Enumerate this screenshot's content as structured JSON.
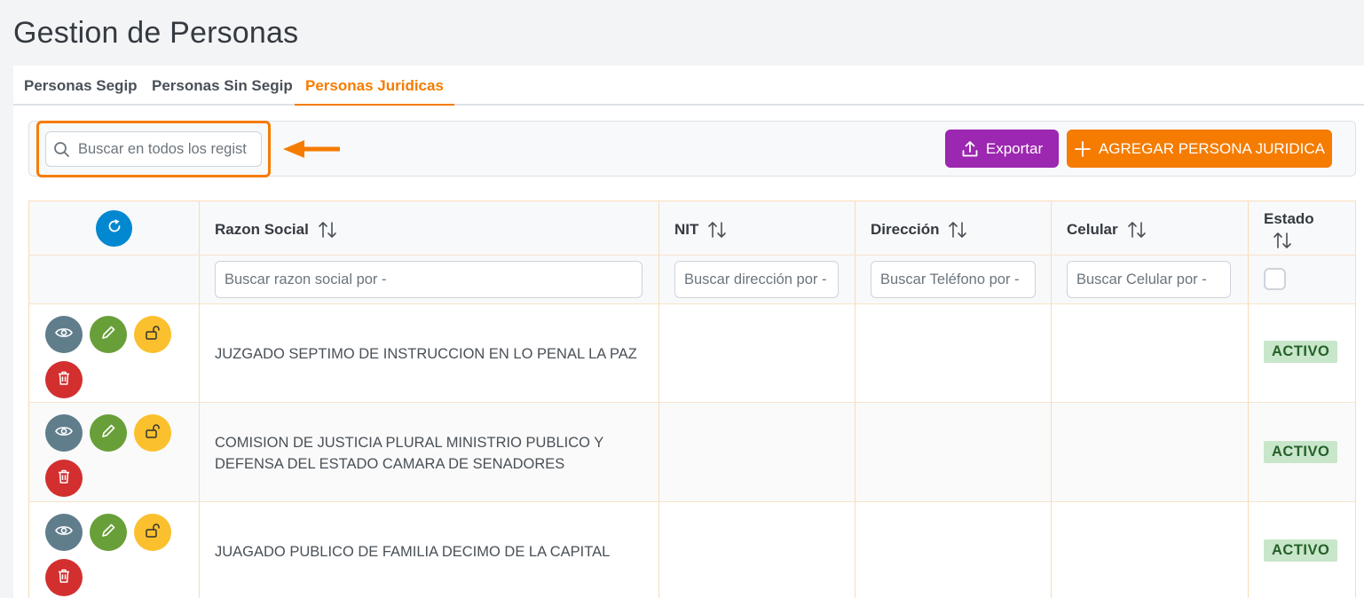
{
  "page": {
    "title": "Gestion de Personas"
  },
  "tabs": [
    {
      "label": "Personas Segip",
      "active": false
    },
    {
      "label": "Personas Sin Segip",
      "active": false
    },
    {
      "label": "Personas Juridicas",
      "active": true
    }
  ],
  "toolbar": {
    "search_placeholder": "Buscar en todos los regist",
    "export_label": "Exportar",
    "add_label": "AGREGAR PERSONA JURIDICA"
  },
  "table": {
    "columns": [
      "Razon Social",
      "NIT",
      "Dirección",
      "Celular",
      "Estado"
    ],
    "filters": {
      "razon_social": "Buscar razon social por -",
      "nit": "Buscar dirección por -",
      "direccion": "Buscar Teléfono por -",
      "celular": "Buscar Celular por -"
    },
    "rows": [
      {
        "razon_social": "JUZGADO SEPTIMO DE INSTRUCCION EN LO PENAL LA PAZ",
        "nit": "",
        "direccion": "",
        "celular": "",
        "estado": "ACTIVO"
      },
      {
        "razon_social_line1": "COMISION DE JUSTICIA PLURAL MINISTRIO PUBLICO Y",
        "razon_social_line2": "DEFENSA DEL ESTADO CAMARA DE SENADORES",
        "nit": "",
        "direccion": "",
        "celular": "",
        "estado": "ACTIVO"
      },
      {
        "razon_social": "JUAGADO PUBLICO DE FAMILIA DECIMO DE LA CAPITAL",
        "nit": "",
        "direccion": "",
        "celular": "",
        "estado": "ACTIVO"
      }
    ]
  },
  "colors": {
    "accent": "#f57c00",
    "export": "#9c27b0",
    "refresh": "#0288d1",
    "view": "#607d8b",
    "edit": "#689f38",
    "lock": "#fbc02d",
    "delete": "#d32f2f",
    "active_badge_bg": "#c8e6c9",
    "active_badge_text": "#256029"
  },
  "icons": [
    "search-icon",
    "upload-icon",
    "plus-icon",
    "refresh-icon",
    "sort-icon",
    "eye-icon",
    "pencil-icon",
    "unlock-icon",
    "trash-icon",
    "arrow-left-icon"
  ]
}
